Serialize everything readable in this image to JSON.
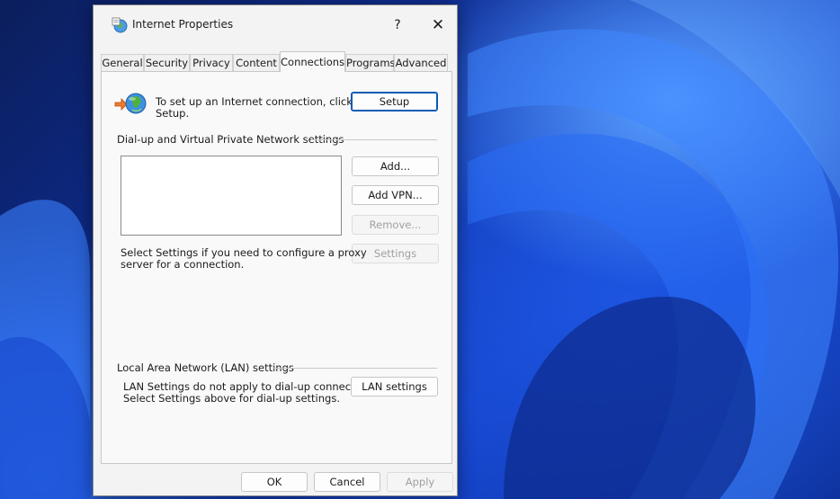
{
  "dialog": {
    "title": "Internet Properties",
    "help_label": "?",
    "close_label": "✕"
  },
  "tabs": [
    {
      "label": "General"
    },
    {
      "label": "Security"
    },
    {
      "label": "Privacy"
    },
    {
      "label": "Content"
    },
    {
      "label": "Connections",
      "active": true
    },
    {
      "label": "Programs"
    },
    {
      "label": "Advanced"
    }
  ],
  "setup": {
    "text_line1": "To set up an Internet connection, click",
    "text_line2": "Setup.",
    "button": "Setup"
  },
  "dialup": {
    "heading": "Dial-up and Virtual Private Network settings",
    "add_button": "Add...",
    "add_vpn_button": "Add VPN...",
    "remove_button": "Remove...",
    "settings_button": "Settings",
    "proxy_text_line1": "Select Settings if you need to configure a proxy",
    "proxy_text_line2": "server for a connection."
  },
  "lan": {
    "heading": "Local Area Network (LAN) settings",
    "text_line1": "LAN Settings do not apply to dial-up connections.",
    "text_line2": "Select Settings above for dial-up settings.",
    "button": "LAN settings"
  },
  "footer": {
    "ok": "OK",
    "cancel": "Cancel",
    "apply": "Apply"
  }
}
